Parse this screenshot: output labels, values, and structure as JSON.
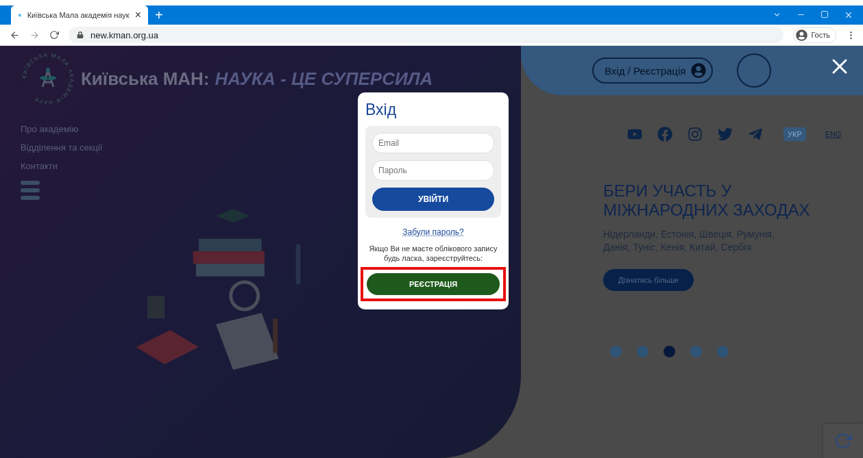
{
  "browser": {
    "tab": {
      "title": "Київська Мала академія наук",
      "close": "×"
    },
    "new_tab": "+",
    "url": "new.kman.org.ua",
    "profile": "Гость"
  },
  "site": {
    "logo_text": "КИЇВСЬКА МАЛА АКАДЕМІЯ НАУК",
    "title": "Київська МАН:",
    "slogan": "НАУКА - ЦЕ СУПЕРСИЛА",
    "nav": [
      "Про академію",
      "Відділення та секції",
      "Контакти"
    ],
    "login_button": "Вхід / Реєстрація",
    "languages": [
      {
        "label": "УКР",
        "selected": true
      },
      {
        "label": "ENG",
        "selected": false
      }
    ],
    "headline": [
      "БЕРИ УЧАСТЬ У",
      "МІЖНАРОДНИХ ЗАХОДАХ"
    ],
    "text": "Нідерланди, Естонія, Швеція, Румунія,\nДанія, Туніс, Кенія, Китай, Сербія",
    "more_button": "Дізнатись більше",
    "slides": [
      {
        "selected": false
      },
      {
        "selected": false
      },
      {
        "selected": true
      },
      {
        "selected": false
      },
      {
        "selected": false
      }
    ]
  },
  "modal": {
    "title": "Вхід",
    "email": {
      "placeholder": "Email"
    },
    "password": {
      "placeholder": "Пароль"
    },
    "login_button": "УВІЙТИ",
    "forgot_link": "Забули пароль?",
    "register_hint": "Якщо Ви не маєте облікового запису\nбудь ласка, зареєструйтесь:",
    "register_button": "РЕЄСТРАЦІЯ",
    "register_highlighted": true
  }
}
